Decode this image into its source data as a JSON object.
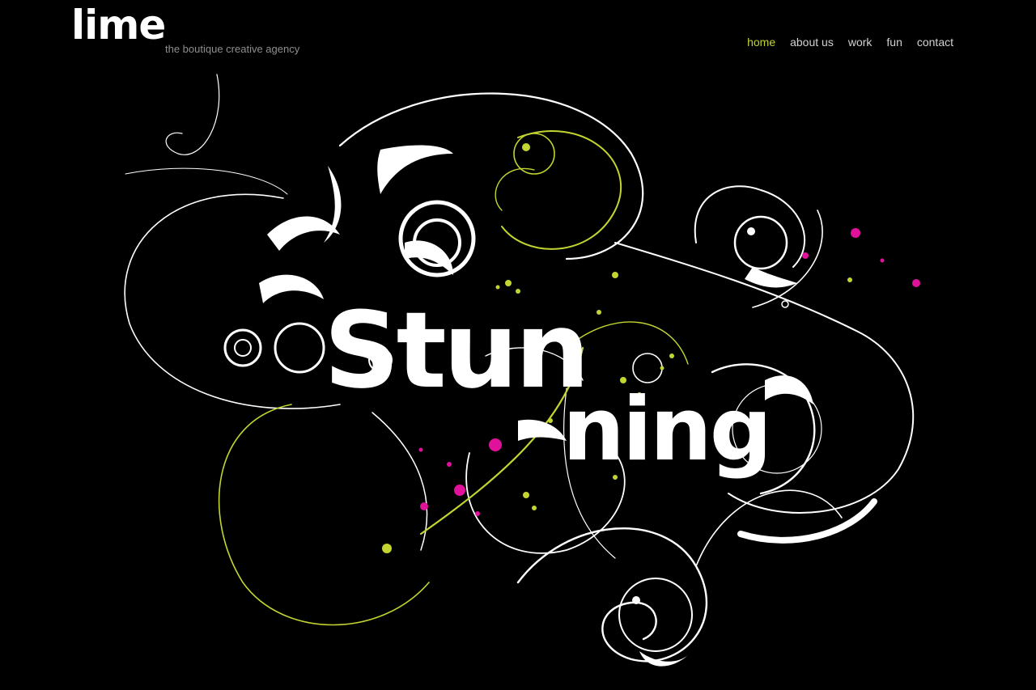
{
  "brand": {
    "logo": "lime",
    "tagline": "the boutique creative agency"
  },
  "nav": {
    "items": [
      {
        "label": "home",
        "active": true
      },
      {
        "label": "about us",
        "active": false
      },
      {
        "label": "work",
        "active": false
      },
      {
        "label": "fun",
        "active": false
      },
      {
        "label": "contact",
        "active": false
      }
    ]
  },
  "hero": {
    "word_part1": "Stun",
    "word_part2": "ning",
    "artwork": "swirl-ornament-illustration"
  },
  "colors": {
    "background": "#000000",
    "accent": "#c3d530",
    "splash": "#e0119a",
    "text": "#ffffff",
    "muted": "#8e8e8e"
  }
}
